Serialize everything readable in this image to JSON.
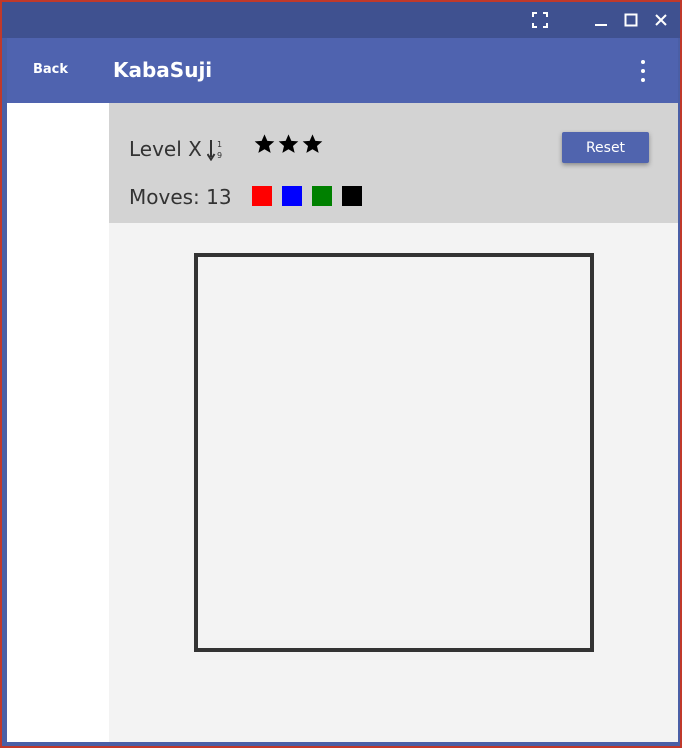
{
  "window": {
    "icons": [
      "fullscreen-icon",
      "minimize-icon",
      "maximize-icon",
      "close-icon"
    ]
  },
  "appbar": {
    "back_label": "Back",
    "title": "KabaSuji",
    "menu_icon": "more-vert-icon",
    "color": "#4f63af"
  },
  "level": {
    "label": "Level X",
    "sort_icon": "sort-numeric-icon",
    "sort_digits": [
      "1",
      "9"
    ],
    "stars": 3,
    "reset_label": "Reset"
  },
  "moves": {
    "label": "Moves: 13",
    "colors": [
      "#ff0000",
      "#0000ff",
      "#008000",
      "#000000"
    ]
  }
}
